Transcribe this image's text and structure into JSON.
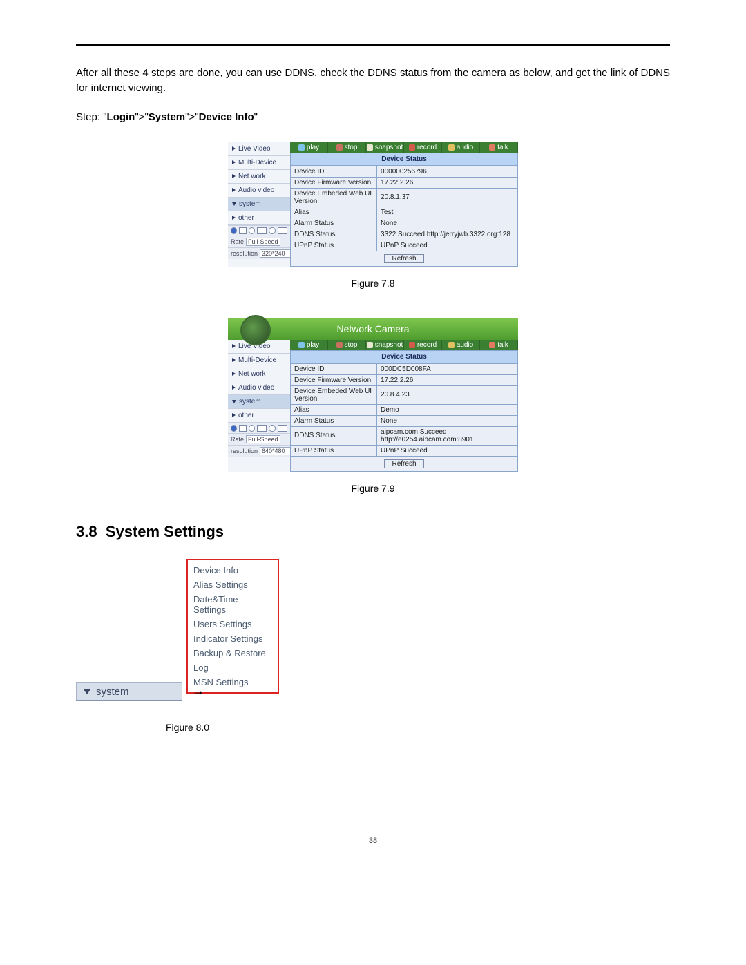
{
  "intro": {
    "para": "After all these 4 steps are done, you can use DDNS, check the DDNS status from the camera as below, and get the link of DDNS for internet viewing.",
    "step_prefix": "Step: \"",
    "step_a": "Login",
    "sep1": "\">\"",
    "step_b": "System",
    "sep2": "\">\"",
    "step_c": "Device Info",
    "suffix": "\""
  },
  "cam": {
    "title": "Network Camera",
    "nav": [
      "Live Video",
      "Multi-Device",
      "Net work",
      "Audio video",
      "system",
      "other"
    ],
    "topbtns": [
      "play",
      "stop",
      "snapshot",
      "record",
      "audio",
      "talk"
    ],
    "device_status": "Device Status",
    "keys": [
      "Device ID",
      "Device Firmware Version",
      "Device Embeded Web UI Version",
      "Alias",
      "Alarm Status",
      "DDNS Status",
      "UPnP Status"
    ],
    "refresh": "Refresh",
    "rate_lbl": "Rate",
    "res_lbl": "resolution"
  },
  "shot1": {
    "vals": [
      "000000256796",
      "17.22.2.26",
      "20.8.1.37",
      "Test",
      "None",
      "3322 Succeed  http://jerryjwb.3322.org:128",
      "UPnP Succeed"
    ],
    "rate": "Full-Speed",
    "res": "320*240"
  },
  "shot2": {
    "vals": [
      "000DC5D008FA",
      "17.22.2.26",
      "20.8.4.23",
      "Demo",
      "None",
      "aipcam.com  Succeed  http://e0254.aipcam.com:8901",
      "UPnP Succeed"
    ],
    "rate": "Full-Speed",
    "res": "640*480"
  },
  "captions": {
    "c78": "Figure 7.8",
    "c79": "Figure 7.9",
    "c80": "Figure 8.0"
  },
  "section": {
    "num": "3.8",
    "title": "System Settings"
  },
  "sysbtn": "system",
  "sysmenu": [
    "Device Info",
    "Alias Settings",
    "Date&Time Settings",
    "Users Settings",
    "Indicator Settings",
    "Backup & Restore",
    "Log",
    "MSN Settings"
  ],
  "page_number": "38"
}
